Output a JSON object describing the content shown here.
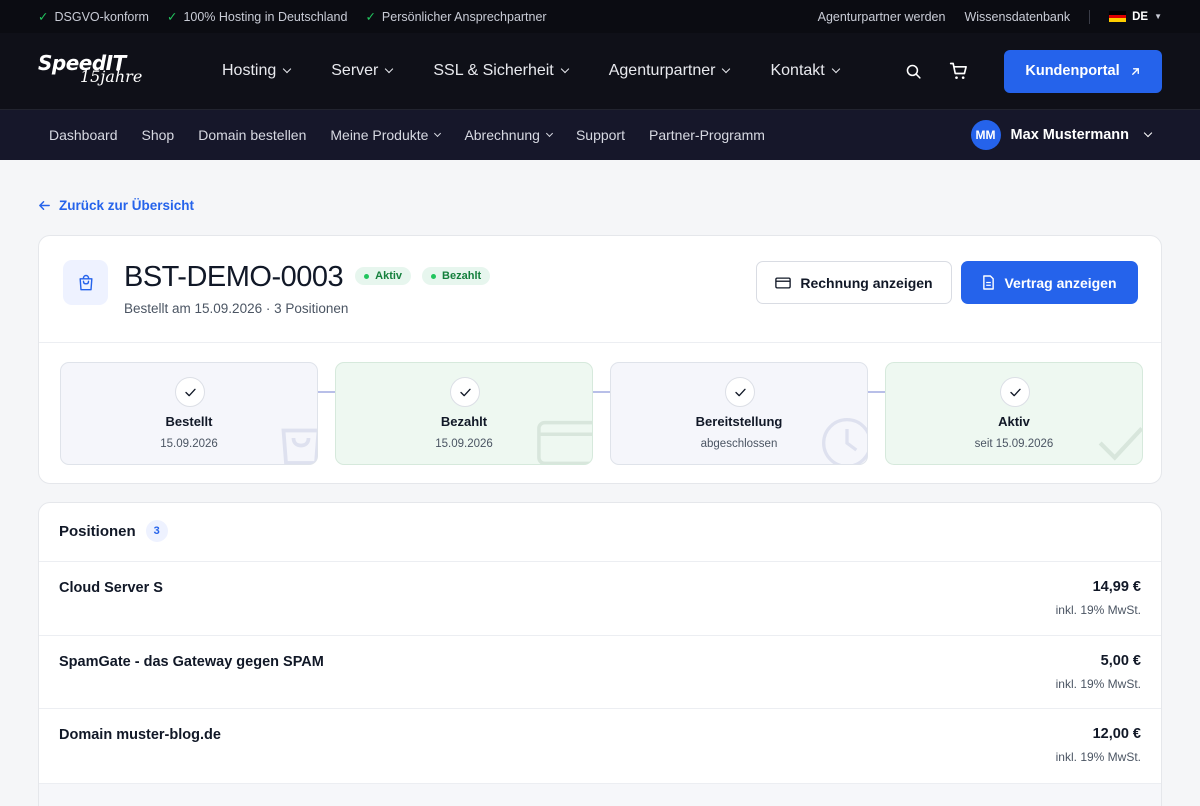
{
  "topbar": {
    "features": [
      "DSGVO-konform",
      "100% Hosting in Deutschland",
      "Persönlicher Ansprechpartner"
    ],
    "links": [
      "Agenturpartner werden",
      "Wissensdatenbank"
    ],
    "language": "DE"
  },
  "brand": {
    "name": "SpeedIT",
    "tagline": "15jahre"
  },
  "mainnav": {
    "items": [
      "Hosting",
      "Server",
      "SSL & Sicherheit",
      "Agenturpartner",
      "Kontakt"
    ],
    "portal_label": "Kundenportal"
  },
  "subnav": {
    "items": [
      "Dashboard",
      "Shop",
      "Domain bestellen",
      "Meine Produkte",
      "Abrechnung",
      "Support",
      "Partner-Programm"
    ],
    "user_initials": "MM",
    "user_name": "Max Mustermann"
  },
  "back_label": "Zurück zur Übersicht",
  "order": {
    "id": "BST-DEMO-0003",
    "badges": [
      "Aktiv",
      "Bezahlt"
    ],
    "meta": "Bestellt am 15.09.2026 · 3 Positionen",
    "invoice_button": "Rechnung anzeigen",
    "contract_button": "Vertrag anzeigen",
    "colors": {
      "accent": "#2563eb",
      "success": "#15803d"
    },
    "steps": [
      {
        "title": "Bestellt",
        "detail": "15.09.2026"
      },
      {
        "title": "Bezahlt",
        "detail": "15.09.2026"
      },
      {
        "title": "Bereitstellung",
        "detail": "abgeschlossen"
      },
      {
        "title": "Aktiv",
        "detail": "seit 15.09.2026"
      }
    ]
  },
  "positions": {
    "title": "Positionen",
    "count": "3",
    "items": [
      {
        "name": "Cloud Server S",
        "price": "14,99 €",
        "vat": "inkl. 19% MwSt."
      },
      {
        "name": "SpamGate - das Gateway gegen SPAM",
        "price": "5,00 €",
        "vat": "inkl. 19% MwSt."
      },
      {
        "name": "Domain muster-blog.de",
        "price": "12,00 €",
        "vat": "inkl. 19% MwSt."
      }
    ]
  }
}
